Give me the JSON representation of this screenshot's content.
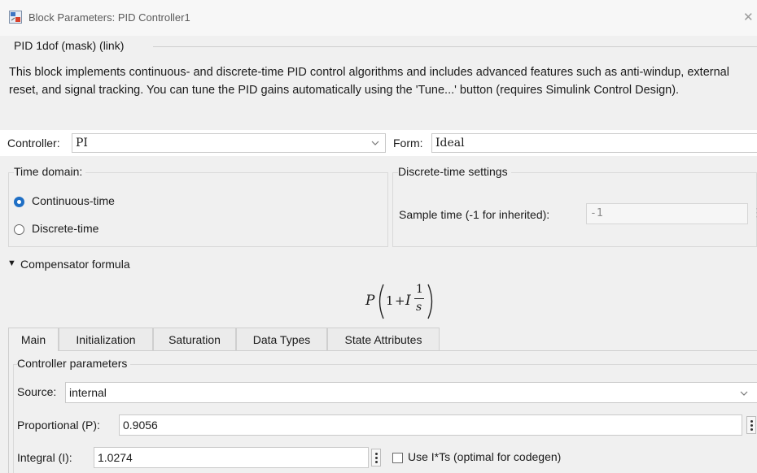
{
  "window": {
    "title": "Block Parameters: PID Controller1",
    "close_glyph": "✕"
  },
  "mask": {
    "title": "PID 1dof (mask) (link)",
    "description": "This block implements continuous- and discrete-time PID control algorithms and includes advanced features such as anti-windup, external reset, and signal tracking. You can tune the PID gains automatically using the 'Tune...' button (requires Simulink Control Design)."
  },
  "controller": {
    "label": "Controller:",
    "value": "PI"
  },
  "form": {
    "label": "Form:",
    "value": "Ideal"
  },
  "time_domain": {
    "title": "Time domain:",
    "options": [
      {
        "label": "Continuous-time",
        "selected": true
      },
      {
        "label": "Discrete-time",
        "selected": false
      }
    ]
  },
  "discrete_settings": {
    "title": "Discrete-time settings",
    "sample_label": "Sample time (-1 for inherited):",
    "sample_value": "-1"
  },
  "compensator": {
    "toggle_glyph": "▼",
    "label": "Compensator formula",
    "formula": {
      "p": "P",
      "one": "1",
      "plus": "+",
      "i": "I",
      "num": "1",
      "den": "s"
    }
  },
  "tabs": [
    {
      "label": "Main",
      "active": true
    },
    {
      "label": "Initialization",
      "active": false
    },
    {
      "label": "Saturation",
      "active": false
    },
    {
      "label": "Data Types",
      "active": false
    },
    {
      "label": "State Attributes",
      "active": false
    }
  ],
  "controller_params": {
    "title": "Controller parameters",
    "source_label": "Source:",
    "source_value": "internal",
    "proportional_label": "Proportional (P):",
    "proportional_value": "0.9056",
    "integral_label": "Integral (I):",
    "integral_value": "1.0274",
    "use_its_label": "Use I*Ts (optimal for codegen)",
    "use_its_checked": false
  },
  "colors": {
    "accent": "#1f6fc5",
    "background": "#f0f0f0",
    "field": "#ffffff"
  },
  "icons": [
    "simulink-block-icon",
    "close-icon",
    "chevron-down-icon",
    "radio-selected-icon",
    "radio-unselected-icon",
    "triangle-down-icon",
    "kebab-menu-icon",
    "checkbox-icon"
  ]
}
